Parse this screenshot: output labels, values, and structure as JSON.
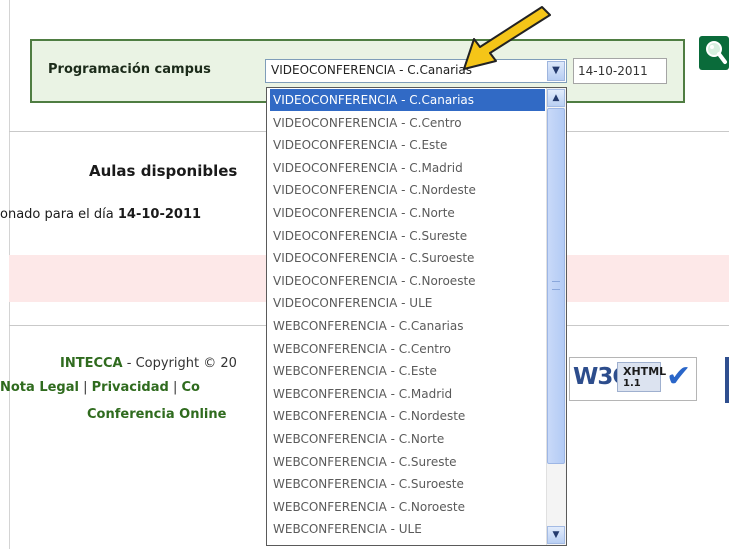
{
  "panel": {
    "label": "Programación campus",
    "selected_option": "VIDEOCONFERENCIA - C.Canarias",
    "date_value": "14-10-2011",
    "dropdown_button": "▼"
  },
  "main": {
    "heading": "Aulas disponibles",
    "selected_prefix": "onado para el día ",
    "selected_date": "14-10-2011"
  },
  "dropdown": {
    "options": [
      "VIDEOCONFERENCIA - C.Canarias",
      "VIDEOCONFERENCIA - C.Centro",
      "VIDEOCONFERENCIA - C.Este",
      "VIDEOCONFERENCIA - C.Madrid",
      "VIDEOCONFERENCIA - C.Nordeste",
      "VIDEOCONFERENCIA - C.Norte",
      "VIDEOCONFERENCIA - C.Sureste",
      "VIDEOCONFERENCIA - C.Suroeste",
      "VIDEOCONFERENCIA - C.Noroeste",
      "VIDEOCONFERENCIA - ULE",
      "WEBCONFERENCIA - C.Canarias",
      "WEBCONFERENCIA - C.Centro",
      "WEBCONFERENCIA - C.Este",
      "WEBCONFERENCIA - C.Madrid",
      "WEBCONFERENCIA - C.Nordeste",
      "WEBCONFERENCIA - C.Norte",
      "WEBCONFERENCIA - C.Sureste",
      "WEBCONFERENCIA - C.Suroeste",
      "WEBCONFERENCIA - C.Noroeste",
      "WEBCONFERENCIA - ULE"
    ],
    "selected_index": 0,
    "scroll_up": "▲",
    "scroll_down": "▼"
  },
  "footer": {
    "brand": "INTECCA",
    "copyright": " - Copyright © 20",
    "nota_legal": "Nota Legal",
    "sep1": " | ",
    "privacidad": "Privacidad",
    "sep2": " | ",
    "co": "Co",
    "conferencia_online": "Conferencia Online"
  },
  "badge": {
    "w3c": "W3C",
    "xhtml": "XHTML",
    "version": "1.1",
    "check": "✔"
  },
  "colors": {
    "accent_green": "#4f7d42",
    "link_green": "#2f6b1e",
    "selection_blue": "#316ac5",
    "arrow_yellow": "#f5c518"
  },
  "icons": [
    "search-icon",
    "arrow-annotation-icon",
    "chevron-down-icon",
    "chevron-up-icon",
    "checkmark-icon"
  ]
}
